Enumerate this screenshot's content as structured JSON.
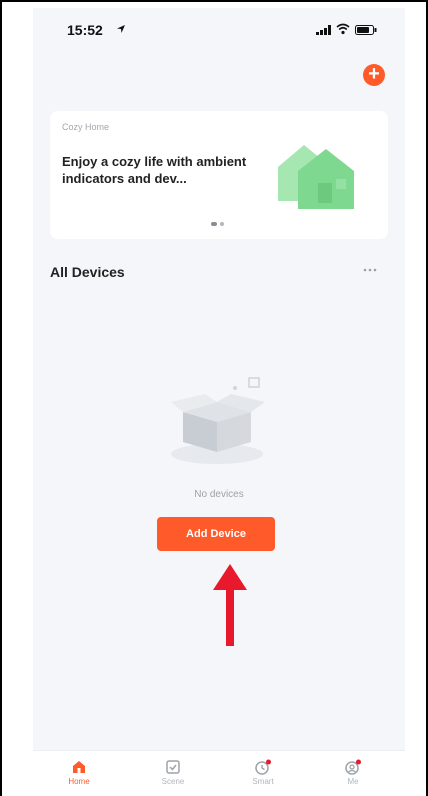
{
  "status": {
    "time": "15:52"
  },
  "banner": {
    "small_label": "Cozy Home",
    "text": "Enjoy a cozy life with ambient indicators and dev..."
  },
  "devices": {
    "section_title": "All Devices",
    "empty_text": "No devices",
    "add_button": "Add Device"
  },
  "tabs": [
    {
      "label": "Home"
    },
    {
      "label": "Scene"
    },
    {
      "label": "Smart"
    },
    {
      "label": "Me"
    }
  ],
  "colors": {
    "accent": "#ff5a2a",
    "annotation_arrow": "#e8192c",
    "banner_house": "#7fd88f"
  }
}
